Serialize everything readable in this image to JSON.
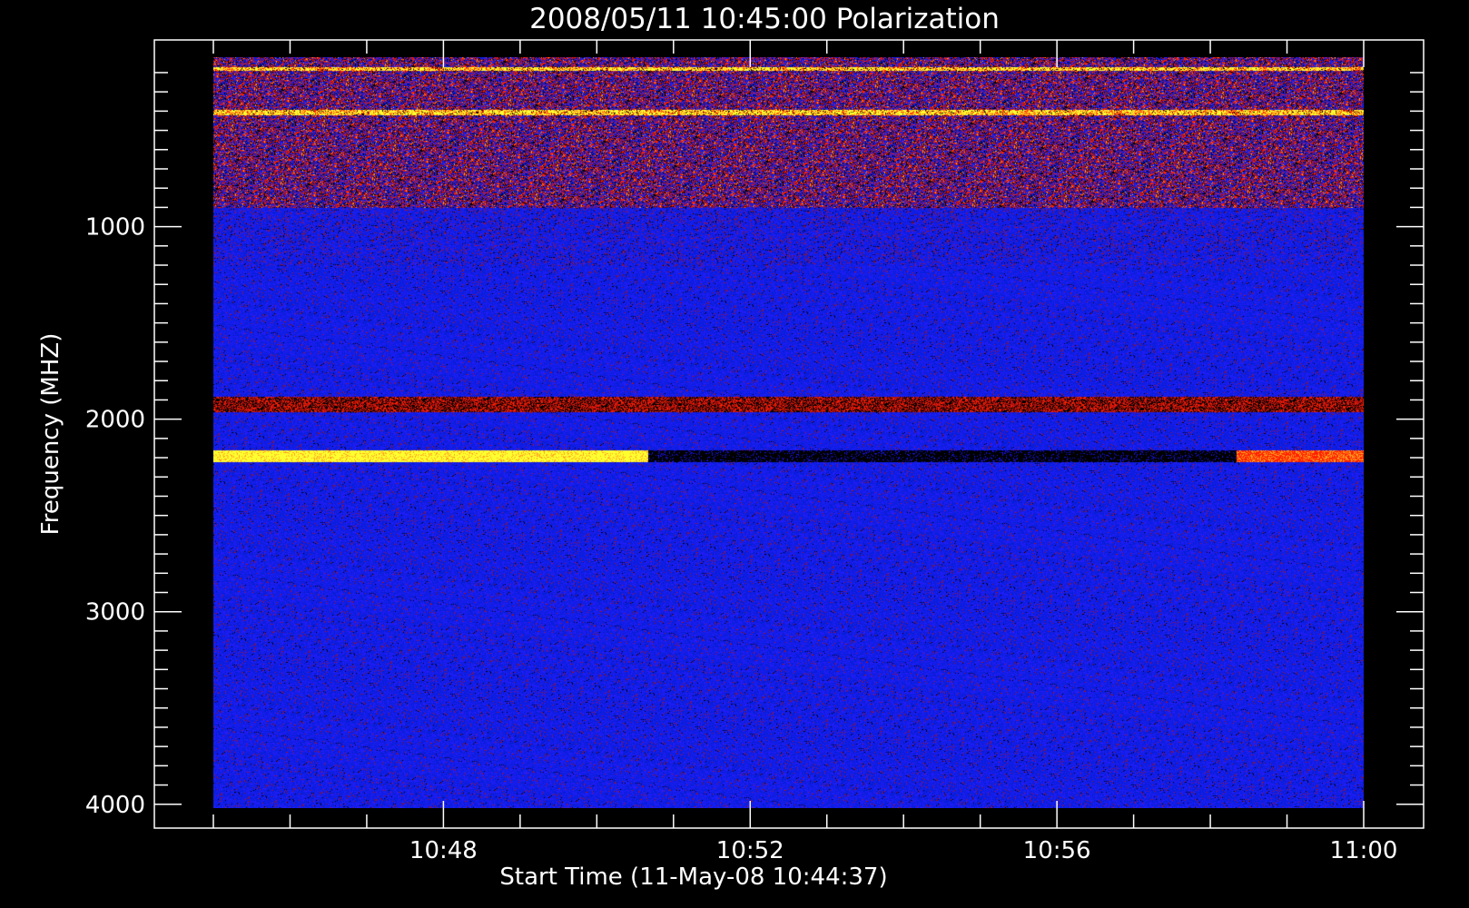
{
  "chart_data": {
    "type": "heatmap",
    "title": "2008/05/11 10:45:00 Polarization",
    "xlabel": "Start Time (11-May-08 10:44:37)",
    "ylabel": "Frequency (MHZ)",
    "x_range": [
      "10:45:00",
      "11:00:00"
    ],
    "y_range": [
      120,
      4020
    ],
    "y_axis_inverted": true,
    "x_ticks": [
      {
        "time": "10:48",
        "label": "10:48"
      },
      {
        "time": "10:52",
        "label": "10:52"
      },
      {
        "time": "10:56",
        "label": "10:56"
      },
      {
        "time": "11:00",
        "label": "11:00"
      }
    ],
    "y_ticks": [
      {
        "value": 1000,
        "label": "1000"
      },
      {
        "value": 2000,
        "label": "2000"
      },
      {
        "value": 3000,
        "label": "3000"
      },
      {
        "value": 4000,
        "label": "4000"
      }
    ],
    "colormap": [
      "#000000",
      "#1a12e0",
      "#2020f5",
      "#b01010",
      "#ff2000",
      "#ffa020",
      "#ffff30"
    ],
    "background_color": "#1d1de8",
    "features": [
      {
        "description": "bright band",
        "freq_range": [
          2160,
          2220
        ],
        "start": "10:45:00",
        "end": "10:50:40",
        "level": "high"
      },
      {
        "description": "dark band",
        "freq_range": [
          2160,
          2220
        ],
        "start": "10:50:40",
        "end": "10:58:20",
        "level": "low"
      },
      {
        "description": "bright band",
        "freq_range": [
          2160,
          2220
        ],
        "start": "10:58:20",
        "end": "11:00:00",
        "level": "medium"
      },
      {
        "description": "mixed band",
        "freq_range": [
          1880,
          1960
        ],
        "start": "10:45:00",
        "end": "11:00:00",
        "level": "mixed"
      },
      {
        "description": "bright line",
        "freq_range": [
          170,
          190
        ],
        "start": "10:45:00",
        "end": "11:00:00",
        "level": "high"
      },
      {
        "description": "bright line",
        "freq_range": [
          390,
          420
        ],
        "start": "10:45:00",
        "end": "11:00:00",
        "level": "high"
      },
      {
        "description": "noisy region",
        "freq_range": [
          120,
          900
        ],
        "start": "10:45:00",
        "end": "11:00:00",
        "level": "mixed"
      }
    ]
  }
}
